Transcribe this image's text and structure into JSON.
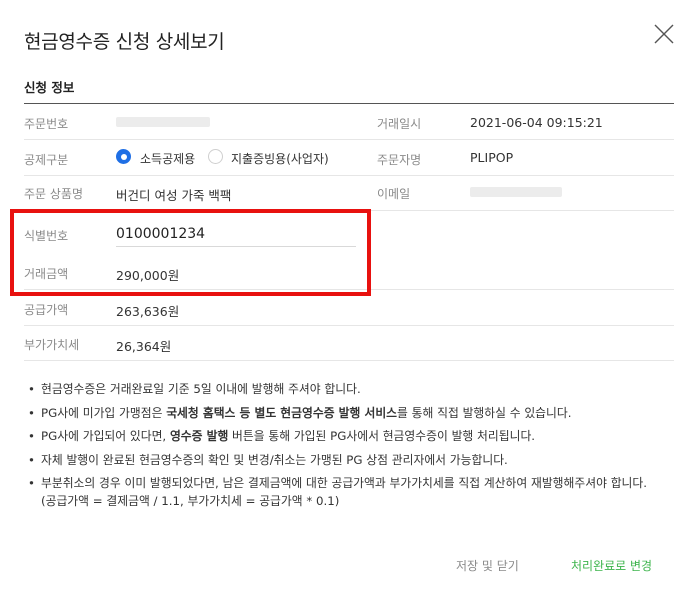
{
  "modal": {
    "title": "현금영수증 신청 상세보기",
    "section_title": "신청 정보"
  },
  "fields": {
    "order_no_label": "주문번호",
    "trade_date_label": "거래일시",
    "trade_date_value": "2021-06-04 09:15:21",
    "deduction_label": "공제구분",
    "deduction_options": [
      "소득공제용",
      "지출증빙용(사업자)"
    ],
    "deduction_selected": "소득공제용",
    "orderer_label": "주문자명",
    "orderer_value": "PLIPOP",
    "product_label": "주문 상품명",
    "product_value": "버건디 여성 가죽 백팩",
    "email_label": "이메일",
    "id_label": "식별번호",
    "id_value": "0100001234",
    "amount_label": "거래금액",
    "amount_value": "290,000원",
    "supply_label": "공급가액",
    "supply_value": "263,636원",
    "vat_label": "부가가치세",
    "vat_value": "26,364원"
  },
  "notes": {
    "n1": "현금영수증은 거래완료일 기준 5일 이내에 발행해 주셔야 합니다.",
    "n2_pre": "PG사에 미가입 가맹점은 ",
    "n2_bold": "국세청 홈택스 등 별도 현금영수증 발행 서비스",
    "n2_post": "를 통해 직접 발행하실 수 있습니다.",
    "n3_pre": "PG사에 가입되어 있다면, ",
    "n3_bold": "영수증 발행",
    "n3_post": " 버튼을 통해 가입된 PG사에서 현금영수증이 발행 처리됩니다.",
    "n4": "자체 발행이 완료된 현금영수증의 확인 및 변경/취소는 가맹된 PG 상점 관리자에서 가능합니다.",
    "n5_line1": "부분취소의 경우 이미 발행되었다면, 남은 결제금액에 대한 공급가액과 부가가치세를 직접 계산하여 재발행해주셔야 합니다.",
    "n5_line2": "(공급가액 = 결제금액 / 1.1, 부가가치세 = 공급가액 * 0.1)"
  },
  "buttons": {
    "save_close": "저장 및 닫기",
    "mark_complete": "처리완료로 변경"
  },
  "colors": {
    "accent_blue": "#1f6fe5",
    "highlight_red": "#e8110f",
    "complete_green": "#3cb44b"
  }
}
